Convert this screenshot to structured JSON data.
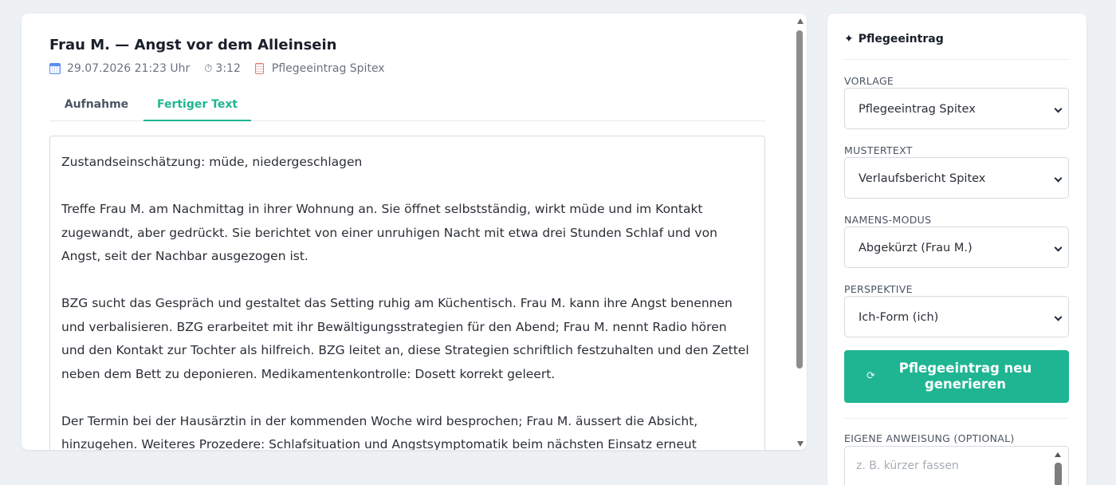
{
  "entry": {
    "title": "Frau M. — Angst vor dem Alleinsein",
    "date": "29.07.2026 21:23 Uhr",
    "duration": "3:12",
    "template": "Pflegeeintrag Spitex"
  },
  "tabs": [
    {
      "label": "Aufnahme"
    },
    {
      "label": "Fertiger Text"
    }
  ],
  "final_text": {
    "paragraphs": [
      "Zustandseinschätzung: müde, niedergeschlagen",
      "Treffe Frau M. am Nachmittag in ihrer Wohnung an. Sie öffnet selbstständig, wirkt müde und im Kontakt zugewandt, aber gedrückt. Sie berichtet von einer unruhigen Nacht mit etwa drei Stunden Schlaf und von Angst, seit der Nachbar ausgezogen ist.",
      "BZG sucht das Gespräch und gestaltet das Setting ruhig am Küchentisch. Frau M. kann ihre Angst benennen und verbalisieren. BZG erarbeitet mit ihr Bewältigungsstrategien für den Abend; Frau M. nennt Radio hören und den Kontakt zur Tochter als hilfreich. BZG leitet an, diese Strategien schriftlich festzuhalten und den Zettel neben dem Bett zu deponieren. Medikamentenkontrolle: Dosett korrekt geleert.",
      "Der Termin bei der Hausärztin in der kommenden Woche wird besprochen; Frau M. äussert die Absicht, hinzugehen. Weiteres Prozedere: Schlafsituation und Angstsymptomatik beim nächsten Einsatz erneut erfragen."
    ]
  },
  "sidebar": {
    "title": "Pflegeeintrag",
    "title_icon": "✦",
    "fields": [
      {
        "label": "VORLAGE",
        "value": "Pflegeeintrag Spitex"
      },
      {
        "label": "MUSTERTEXT",
        "value": "Verlaufsbericht Spitex"
      },
      {
        "label": "NAMENS-MODUS",
        "value": "Abgekürzt (Frau M.)"
      },
      {
        "label": "PERSPEKTIVE",
        "value": "Ich-Form (ich)"
      }
    ],
    "generate_button": "Pflegeeintrag neu generieren",
    "generate_icon": "⟳",
    "custom_label": "EIGENE ANWEISUNG (OPTIONAL)",
    "custom_placeholder": "z. B. kürzer fassen"
  },
  "colors": {
    "accent": "#1fb592",
    "background": "#eef1f4"
  }
}
